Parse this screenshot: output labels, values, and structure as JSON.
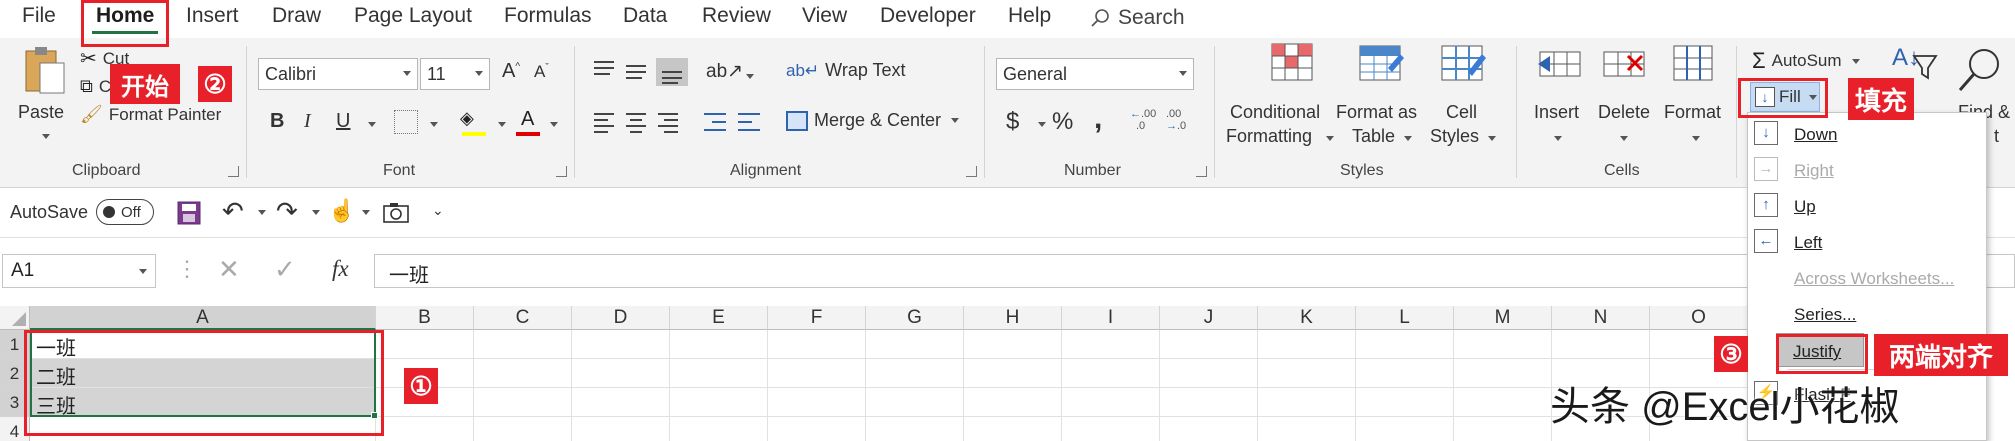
{
  "tabs": [
    "File",
    "Home",
    "Insert",
    "Draw",
    "Page Layout",
    "Formulas",
    "Data",
    "Review",
    "View",
    "Developer",
    "Help"
  ],
  "search_label": "Search",
  "clipboard": {
    "paste": "Paste",
    "cut": "Cut",
    "copy": "Copy",
    "format_painter": "Format Painter",
    "group": "Clipboard"
  },
  "font": {
    "name": "Calibri",
    "size": "11",
    "bold": "B",
    "italic": "I",
    "underline": "U",
    "grow": "A",
    "shrink": "A",
    "color_a": "A",
    "group": "Font"
  },
  "alignment": {
    "wrap": "Wrap Text",
    "merge": "Merge & Center",
    "group": "Alignment"
  },
  "number": {
    "format": "General",
    "currency": "$",
    "percent": "%",
    "comma": ",",
    "inc": ".00",
    "dec": ".00",
    "group": "Number"
  },
  "styles": {
    "cond_1": "Conditional",
    "cond_2": "Formatting",
    "fmt_1": "Format as",
    "fmt_2": "Table",
    "cell_1": "Cell",
    "cell_2": "Styles",
    "group": "Styles"
  },
  "cells": {
    "insert": "Insert",
    "delete": "Delete",
    "format": "Format",
    "group": "Cells"
  },
  "editing": {
    "autosum": "AutoSum",
    "fill": "Fill",
    "find_a": "Find &",
    "find_b": "t"
  },
  "qat": {
    "autosave": "AutoSave",
    "toggle": "Off"
  },
  "formula": {
    "namebox": "A1",
    "fx": "fx",
    "value": "一班"
  },
  "columns": [
    "A",
    "B",
    "C",
    "D",
    "E",
    "F",
    "G",
    "H",
    "I",
    "J",
    "K",
    "L",
    "M",
    "N",
    "O"
  ],
  "rows": [
    "1",
    "2",
    "3",
    "4"
  ],
  "cells_data": [
    "一班",
    "二班",
    "三班"
  ],
  "fill_menu": [
    {
      "label": "Down",
      "enabled": true,
      "icon": "fill-down-icon"
    },
    {
      "label": "Right",
      "enabled": false,
      "icon": "fill-right-icon"
    },
    {
      "label": "Up",
      "enabled": true,
      "icon": "fill-up-icon"
    },
    {
      "label": "Left",
      "enabled": true,
      "icon": "fill-left-icon"
    },
    {
      "label": "Across Worksheets...",
      "enabled": false,
      "icon": ""
    },
    {
      "label": "Series...",
      "enabled": true,
      "icon": ""
    },
    {
      "label": "Justify",
      "enabled": true,
      "icon": ""
    },
    {
      "label": "Flash F",
      "enabled": true,
      "icon": "flash-fill-icon"
    }
  ],
  "annotations": {
    "home_zh": "开始",
    "fill_zh": "填充",
    "justify_zh": "两端对齐",
    "step1": "①",
    "step2": "②",
    "step3": "③"
  },
  "watermark": "头条 @Excel小花椒",
  "colors": {
    "accent_green": "#217346",
    "annotation_red": "#e8202a",
    "ribbon_bg": "#f3f3f3"
  }
}
